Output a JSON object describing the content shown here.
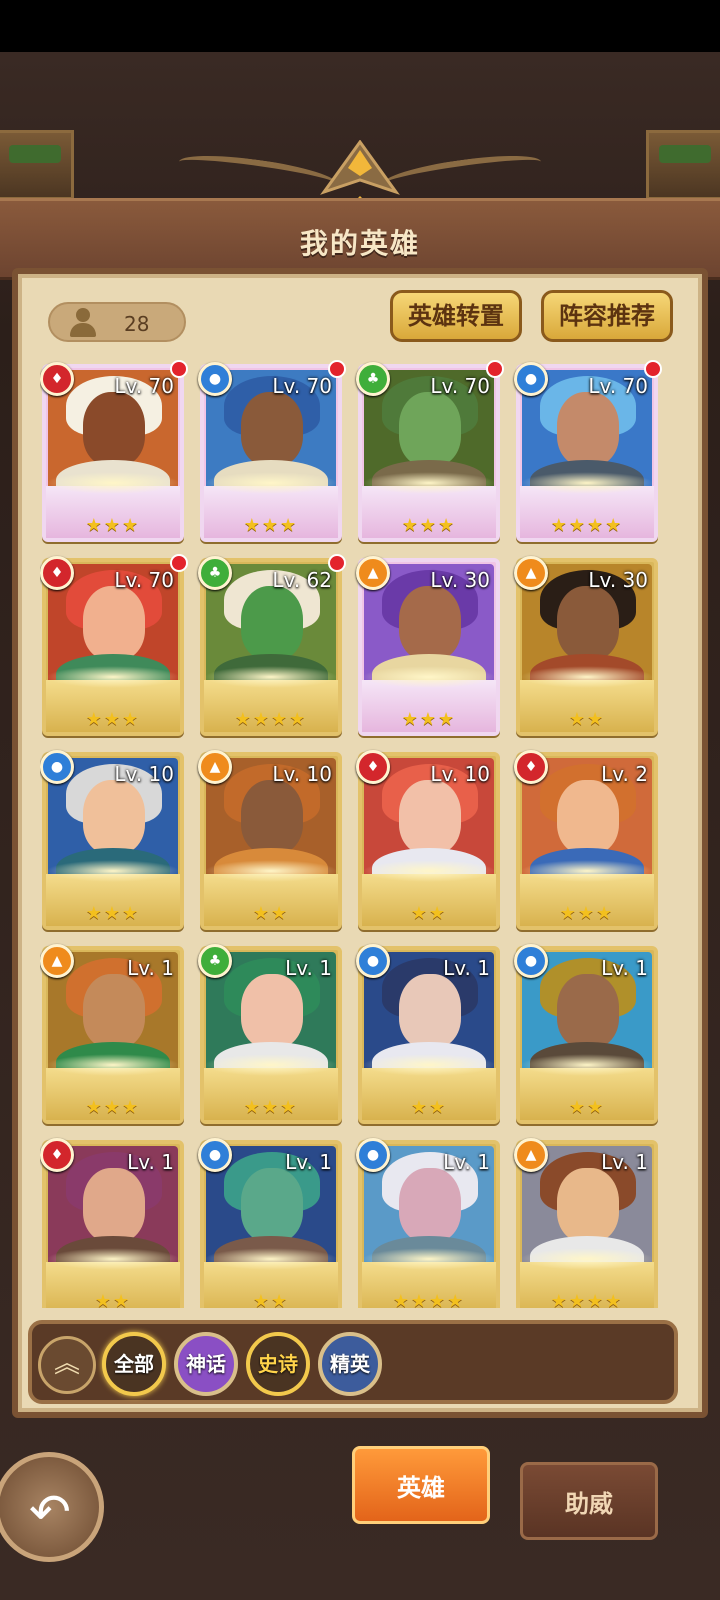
{
  "header": {
    "title": "我的英雄"
  },
  "hero_count": "28",
  "buttons": {
    "transfer": "英雄转置",
    "lineup": "阵容推荐"
  },
  "heroes": [
    {
      "level": "Lv. 70",
      "element": "fire",
      "stars": "★★★",
      "badge": true
    },
    {
      "level": "Lv. 70",
      "element": "water",
      "stars": "★★★",
      "badge": true
    },
    {
      "level": "Lv. 70",
      "element": "nature",
      "stars": "★★★",
      "badge": true
    },
    {
      "level": "Lv. 70",
      "element": "water",
      "stars": "★★★★",
      "badge": true
    },
    {
      "level": "Lv. 70",
      "element": "fire",
      "stars": "★★★",
      "badge": true
    },
    {
      "level": "Lv. 62",
      "element": "nature",
      "stars": "★★★★",
      "badge": true
    },
    {
      "level": "Lv. 30",
      "element": "light",
      "stars": "★★★",
      "badge": false
    },
    {
      "level": "Lv. 30",
      "element": "light",
      "stars": "★★",
      "badge": false
    },
    {
      "level": "Lv. 10",
      "element": "water",
      "stars": "★★★",
      "badge": false
    },
    {
      "level": "Lv. 10",
      "element": "light",
      "stars": "★★",
      "badge": false
    },
    {
      "level": "Lv. 10",
      "element": "fire",
      "stars": "★★",
      "badge": false
    },
    {
      "level": "Lv. 2",
      "element": "fire",
      "stars": "★★★",
      "badge": false
    },
    {
      "level": "Lv. 1",
      "element": "light",
      "stars": "★★★",
      "badge": false
    },
    {
      "level": "Lv. 1",
      "element": "nature",
      "stars": "★★★",
      "badge": false
    },
    {
      "level": "Lv. 1",
      "element": "water",
      "stars": "★★",
      "badge": false
    },
    {
      "level": "Lv. 1",
      "element": "water",
      "stars": "★★",
      "badge": false
    },
    {
      "level": "Lv. 1",
      "element": "fire",
      "stars": "★★",
      "badge": false
    },
    {
      "level": "Lv. 1",
      "element": "water",
      "stars": "★★",
      "badge": false
    },
    {
      "level": "Lv. 1",
      "element": "water",
      "stars": "★★★★",
      "badge": false
    },
    {
      "level": "Lv. 1",
      "element": "light",
      "stars": "★★★★",
      "badge": false
    }
  ],
  "filters": {
    "all": "全部",
    "mythic": "神话",
    "epic": "史诗",
    "elite": "精英",
    "collapse_icon": "double-chevron-up-icon"
  },
  "tabs": {
    "heroes": "英雄",
    "support": "助威"
  },
  "back_icon": "back-arrow-icon",
  "colors": {
    "fire": "#d3262c",
    "water": "#2f7fd8",
    "nature": "#3fae3a",
    "light": "#ef8b1c",
    "accent_tab": "#e3641a"
  }
}
